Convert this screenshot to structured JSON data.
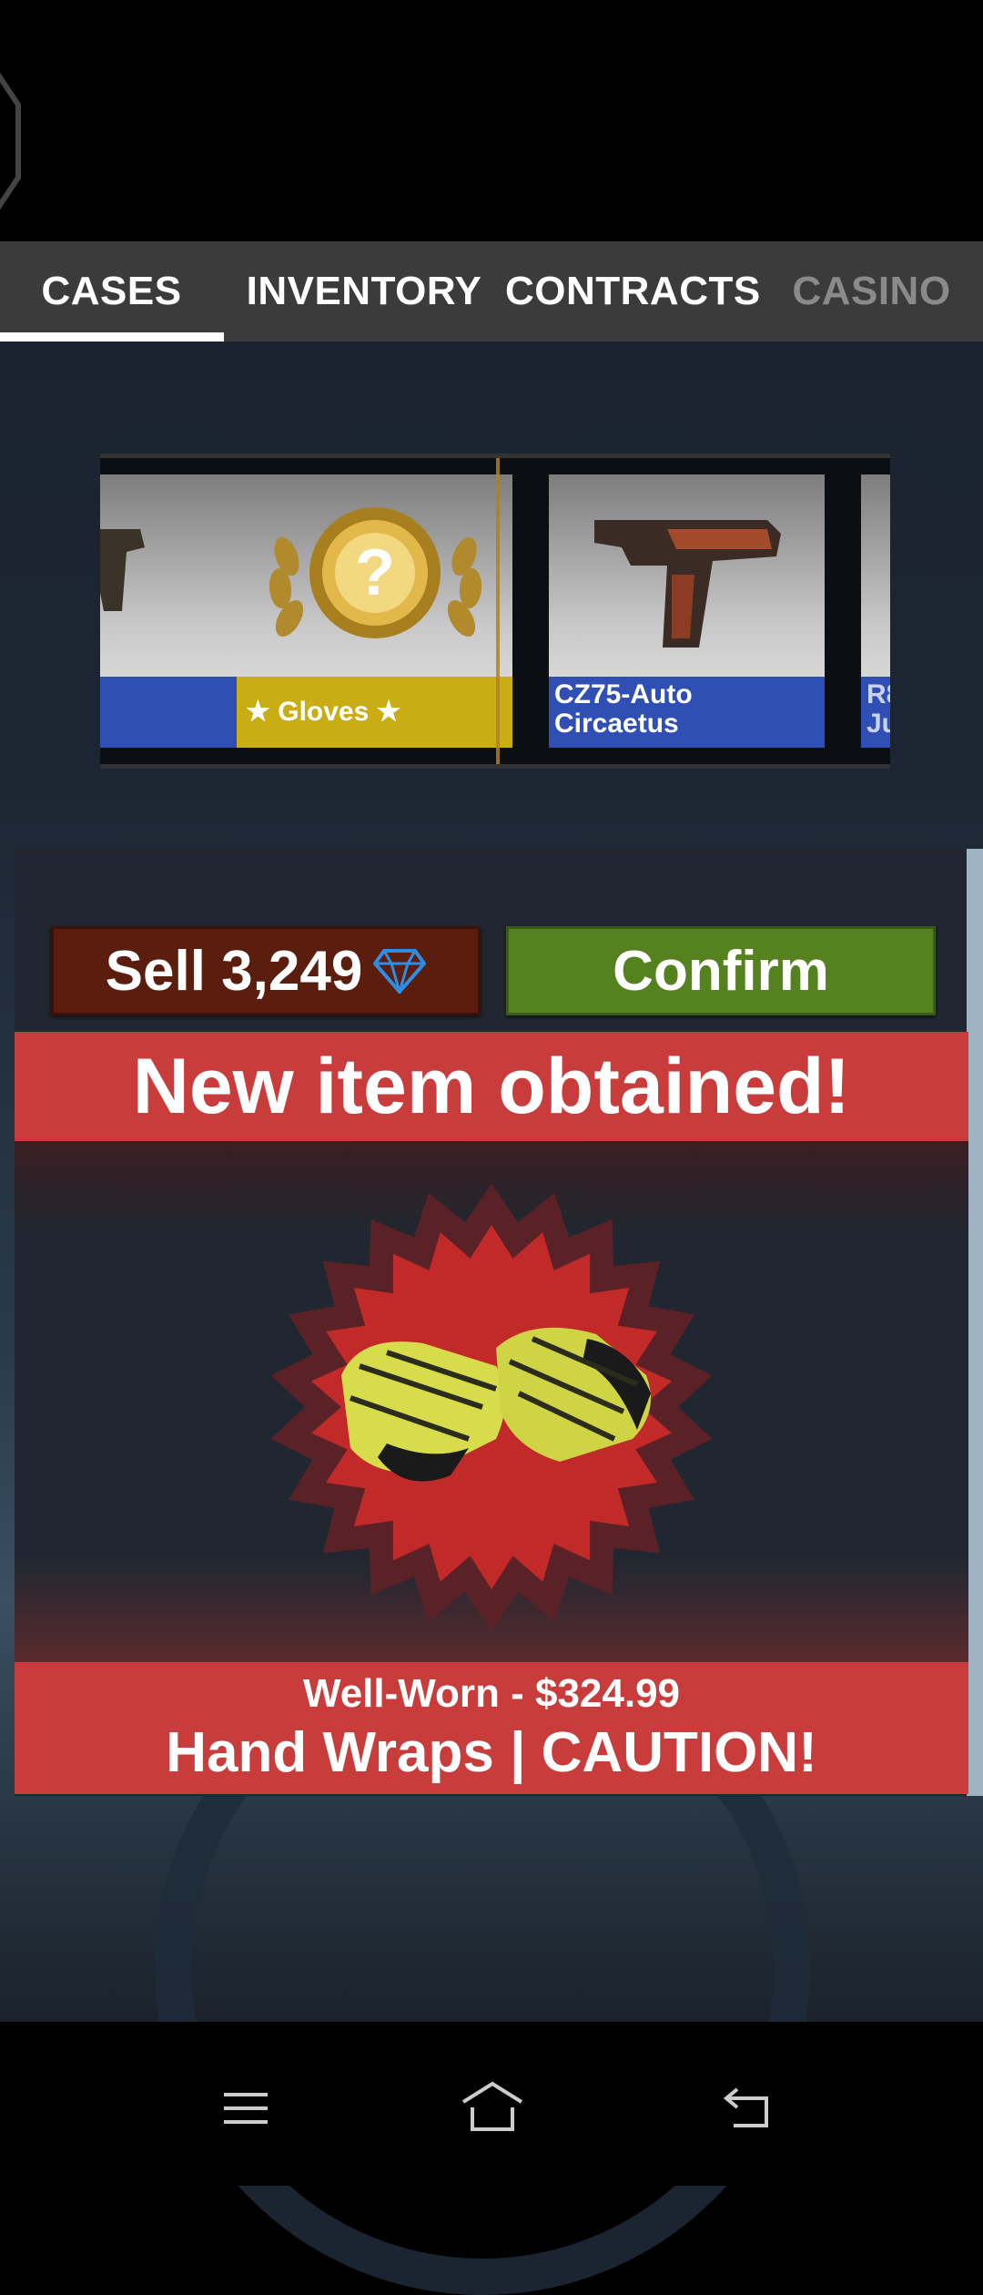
{
  "tabs": [
    {
      "label": "CASES"
    },
    {
      "label": "INVENTORY"
    },
    {
      "label": "CONTRACTS"
    },
    {
      "label": "CASINO"
    }
  ],
  "reel": {
    "items": [
      {
        "label": "",
        "rarity_color": "#2f4fb5"
      },
      {
        "label": "★ Gloves ★",
        "rarity_color": "#c9ad14"
      },
      {
        "label_line1": "CZ75-Auto",
        "label_line2": "Circaetus",
        "rarity_color": "#2f4fb5"
      },
      {
        "label_line1": "R8",
        "label_line2": "Ju",
        "rarity_color": "#2f4fb5"
      }
    ]
  },
  "actions": {
    "sell_label": "Sell 3,249",
    "confirm_label": "Confirm"
  },
  "result": {
    "banner": "New item obtained!",
    "condition_price": "Well-Worn - $324.99",
    "item_name": "Hand Wraps | CAUTION!"
  },
  "colors": {
    "sell": "#5a1d0e",
    "confirm": "#56811f",
    "banner": "#c83c3c",
    "diamond": "#2f8de4"
  },
  "icons": [
    "diamond-icon",
    "menu-icon",
    "home-icon",
    "back-icon"
  ]
}
